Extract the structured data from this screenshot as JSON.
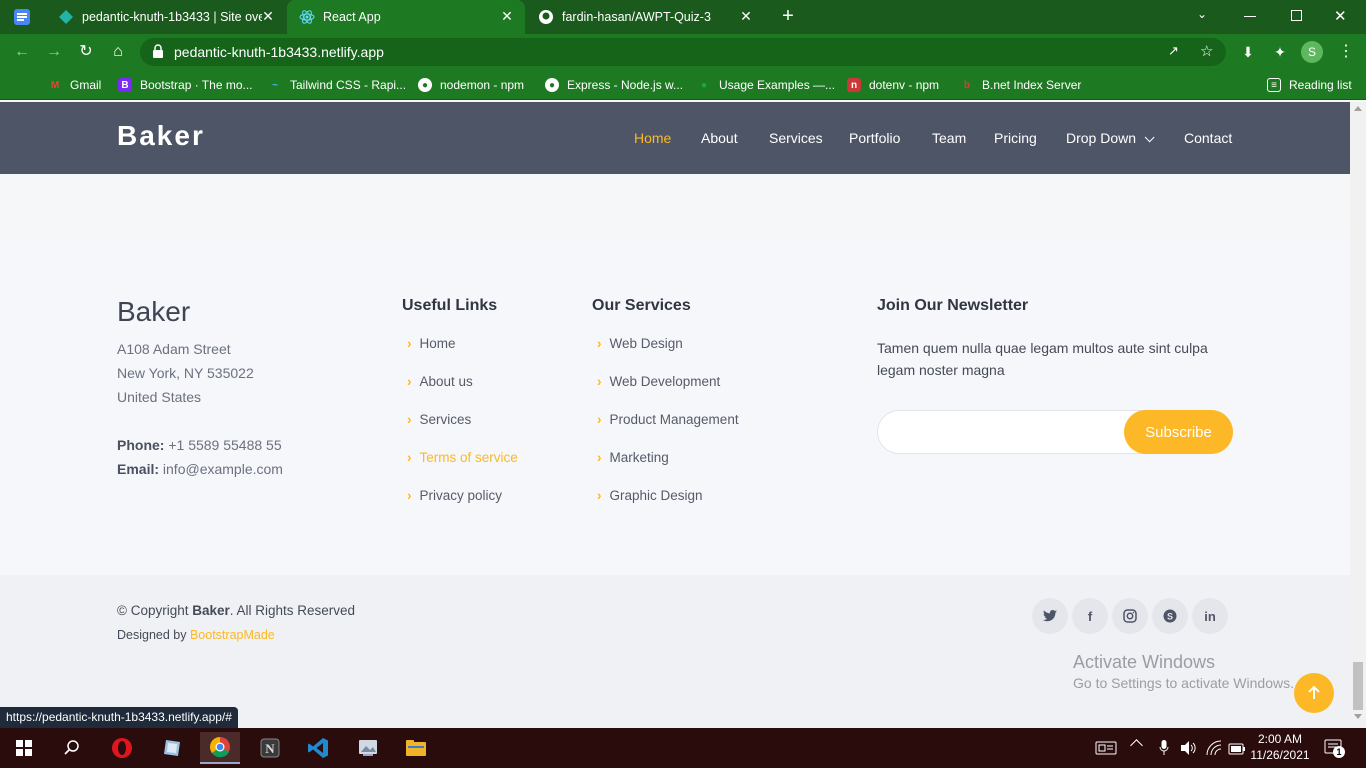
{
  "browser": {
    "tabs": [
      {
        "label": "pedantic-knuth-1b3433 | Site ove",
        "active": false
      },
      {
        "label": "React App",
        "active": true
      },
      {
        "label": "fardin-hasan/AWPT-Quiz-3",
        "active": false
      }
    ],
    "url": "pedantic-knuth-1b3433.netlify.app",
    "profile_initial": "S",
    "bookmarks": [
      {
        "label": "Gmail",
        "icon": "gmail-icon"
      },
      {
        "label": "Bootstrap · The mo...",
        "icon": "bootstrap-icon"
      },
      {
        "label": "Tailwind CSS - Rapi...",
        "icon": "tailwind-icon"
      },
      {
        "label": "nodemon - npm",
        "icon": "globe-icon"
      },
      {
        "label": "Express - Node.js w...",
        "icon": "globe-icon"
      },
      {
        "label": "Usage Examples —...",
        "icon": "mongodb-icon"
      },
      {
        "label": "dotenv - npm",
        "icon": "npm-icon"
      },
      {
        "label": "B.net Index Server",
        "icon": "bnet-icon"
      }
    ],
    "reading_list": "Reading list",
    "status_url": "https://pedantic-knuth-1b3433.netlify.app/#"
  },
  "header": {
    "logo": "Baker",
    "nav": [
      {
        "label": "Home",
        "active": true
      },
      {
        "label": "About"
      },
      {
        "label": "Services"
      },
      {
        "label": "Portfolio"
      },
      {
        "label": "Team"
      },
      {
        "label": "Pricing"
      },
      {
        "label": "Drop Down",
        "dropdown": true
      },
      {
        "label": "Contact"
      }
    ]
  },
  "footer": {
    "brand": "Baker",
    "address": [
      "A108 Adam Street",
      "New York, NY 535022",
      "United States"
    ],
    "phone_label": "Phone:",
    "phone": "+1 5589 55488 55",
    "email_label": "Email:",
    "email": "info@example.com",
    "useful_links_title": "Useful Links",
    "useful_links": [
      "Home",
      "About us",
      "Services",
      "Terms of service",
      "Privacy policy"
    ],
    "services_title": "Our Services",
    "services": [
      "Web Design",
      "Web Development",
      "Product Management",
      "Marketing",
      "Graphic Design"
    ],
    "newsletter_title": "Join Our Newsletter",
    "newsletter_text": "Tamen quem nulla quae legam multos aute sint culpa legam noster magna",
    "subscribe_label": "Subscribe",
    "copyright_prefix": "© Copyright ",
    "copyright_brand": "Baker",
    "copyright_suffix": ". All Rights Reserved",
    "designed_prefix": "Designed by ",
    "designed_link": "BootstrapMade",
    "social": [
      "twitter-icon",
      "facebook-icon",
      "instagram-icon",
      "skype-icon",
      "linkedin-icon"
    ]
  },
  "watermark": {
    "line1": "Activate Windows",
    "line2": "Go to Settings to activate Windows."
  },
  "taskbar": {
    "time": "2:00 AM",
    "date": "11/26/2021",
    "notification_count": "1"
  },
  "colors": {
    "accent": "#fcb826",
    "header_bg": "#4e5567",
    "browser_green": "#1e7a22"
  }
}
